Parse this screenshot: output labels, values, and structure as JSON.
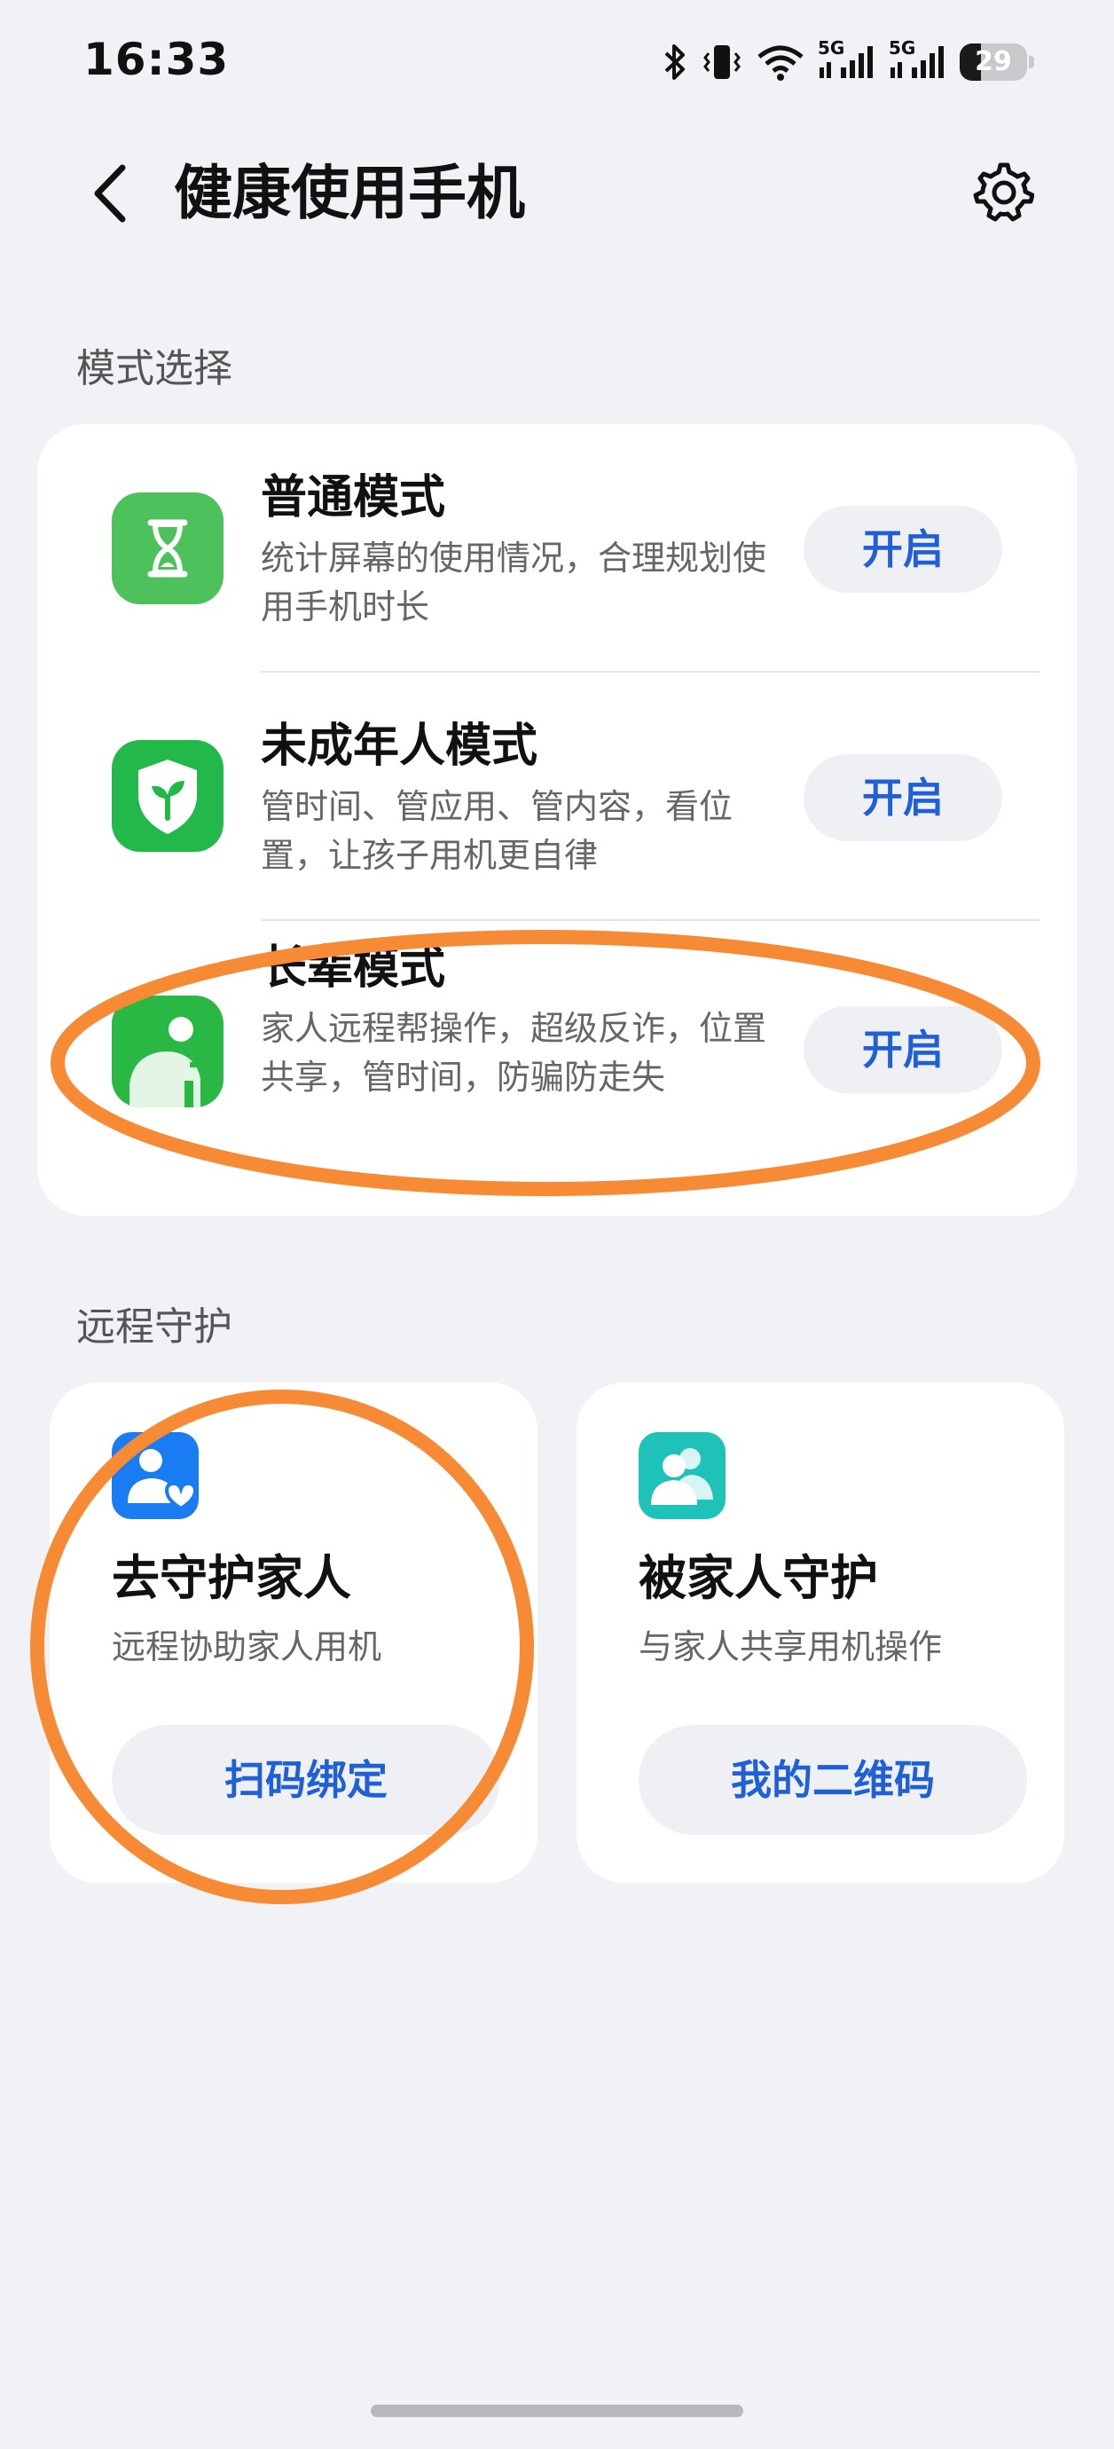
{
  "status_bar": {
    "time": "16:33",
    "signal1_label": "5G",
    "signal2_label": "5G",
    "battery_level": "29",
    "icons": [
      "bluetooth-icon",
      "vibrate-icon",
      "wifi-icon",
      "signal-icon",
      "signal-icon",
      "battery-icon"
    ]
  },
  "header": {
    "title": "健康使用手机",
    "back_icon": "chevron-left-icon",
    "settings_icon": "gear-icon"
  },
  "mode_section": {
    "title": "模式选择",
    "items": [
      {
        "title": "普通模式",
        "desc": "统计屏幕的使用情况，合理规划使用手机时长",
        "button": "开启",
        "icon": "hourglass-icon",
        "icon_color": "#4cc15c"
      },
      {
        "title": "未成年人模式",
        "desc": "管时间、管应用、管内容，看位置，让孩子用机更自律",
        "button": "开启",
        "icon": "shield-sprout-icon",
        "icon_color": "#22b84a"
      },
      {
        "title": "长辈模式",
        "desc": "家人远程帮操作，超级反诈，位置共享，管时间，防骗防走失",
        "button": "开启",
        "icon": "elder-icon",
        "icon_color": "#29b843"
      }
    ]
  },
  "remote_section": {
    "title": "远程守护",
    "cards": [
      {
        "title": "去守护家人",
        "desc": "远程协助家人用机",
        "button": "扫码绑定",
        "icon": "guard-family-icon",
        "icon_color": "#1a7cf2"
      },
      {
        "title": "被家人守护",
        "desc": "与家人共享用机操作",
        "button": "我的二维码",
        "icon": "guarded-by-family-icon",
        "icon_color": "#1fc2b9"
      }
    ]
  },
  "colors": {
    "accent": "#1f5fd8",
    "annotation": "#f78a35",
    "background": "#f1f2f6"
  }
}
